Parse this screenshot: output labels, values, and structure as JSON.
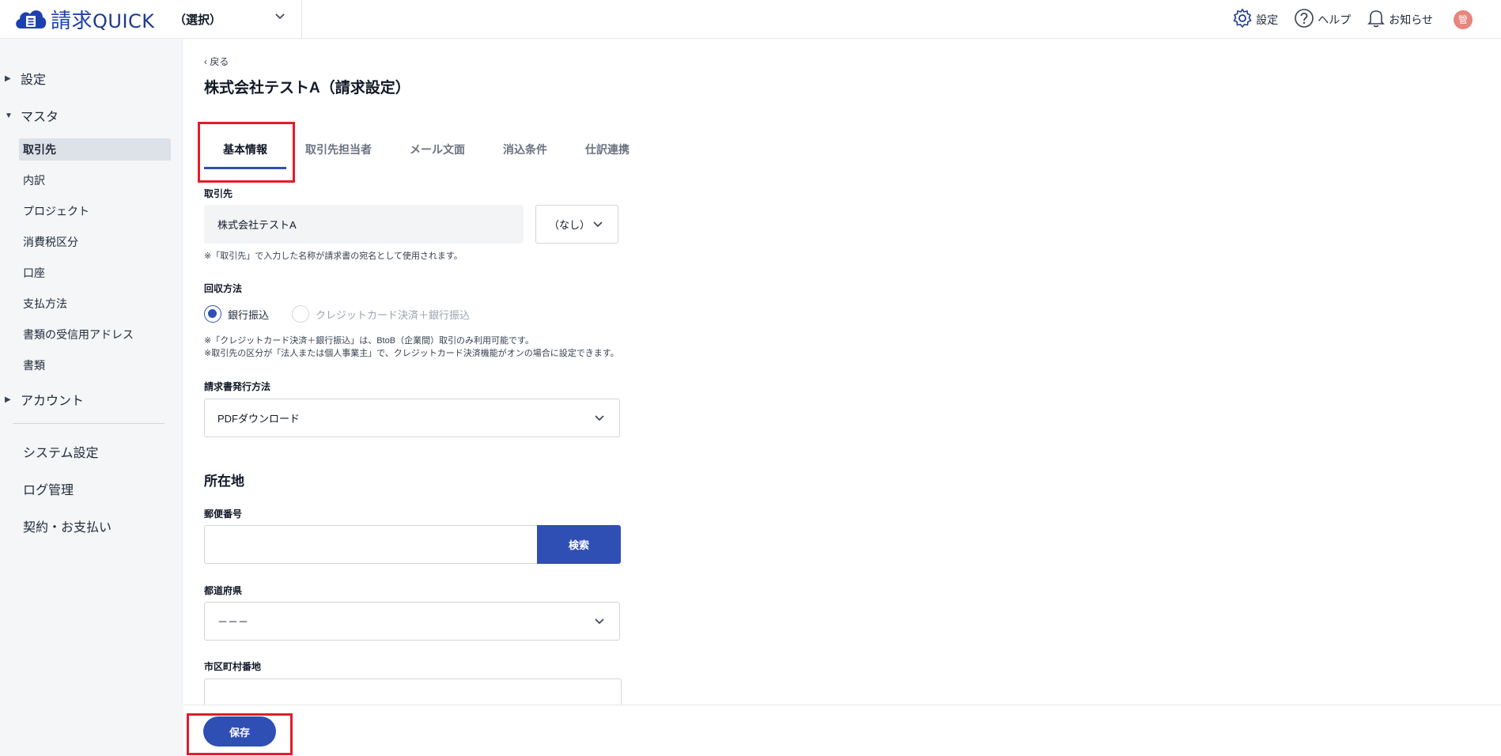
{
  "header": {
    "logo_text": "請求",
    "logo_text_latin": "QUICK",
    "company_select": "（選択）",
    "settings": "設定",
    "help": "ヘルプ",
    "notifications": "お知らせ",
    "avatar": "管"
  },
  "sidebar": {
    "groups": [
      {
        "label": "設定"
      },
      {
        "label": "マスタ"
      },
      {
        "label": "アカウント"
      }
    ],
    "master_items": [
      "取引先",
      "内訳",
      "プロジェクト",
      "消費税区分",
      "口座",
      "支払方法",
      "書類の受信用アドレス",
      "書類"
    ],
    "bottom_items": [
      "システム設定",
      "ログ管理",
      "契約・お支払い"
    ]
  },
  "page": {
    "back": "戻る",
    "title": "株式会社テストA（請求設定）"
  },
  "tabs": [
    "基本情報",
    "取引先担当者",
    "メール文面",
    "消込条件",
    "仕訳連携"
  ],
  "form": {
    "client_label": "取引先",
    "client_value": "株式会社テストA",
    "honorific": "（なし）",
    "client_note": "※「取引先」で入力した名称が請求書の宛名として使用されます。",
    "collection_label": "回収方法",
    "radio_bank": "銀行振込",
    "radio_card": "クレジットカード決済＋銀行振込",
    "collection_note_1": "※「クレジットカード決済＋銀行振込」は、BtoB（企業間）取引のみ利用可能です。",
    "collection_note_2": "※取引先の区分が「法人または個人事業主」で、クレジットカード決済機能がオンの場合に設定できます。",
    "issue_label": "請求書発行方法",
    "issue_value": "PDFダウンロード",
    "address_title": "所在地",
    "postal_label": "郵便番号",
    "postal_value": "",
    "search_button": "検索",
    "prefecture_label": "都道府県",
    "prefecture_value": "－－－",
    "city_label": "市区町村番地"
  },
  "footer": {
    "save": "保存"
  },
  "colors": {
    "accent": "#2f4fb5",
    "highlight": "#e11d2a"
  }
}
